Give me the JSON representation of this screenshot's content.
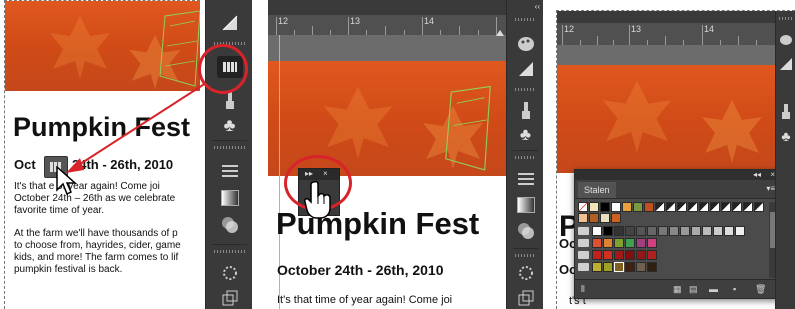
{
  "panel1": {
    "title": "Pumpkin Fest",
    "subtitle_pre": "Oct",
    "subtitle_post": "24th - 26th, 2010",
    "para1": [
      "It's that",
      "e of year again! Come joi",
      "October 24th – 26th as we celebrate",
      "favorite time of year."
    ],
    "para1_lines": [
      "It's that       e of year again! Come joi",
      "October 24th – 26th as we celebrate",
      "favorite time of year."
    ],
    "para2_lines": [
      "At the farm we'll have thousands of p",
      "to choose from, hayrides, cider, game",
      "kids, and more! The farm comes to lif",
      "pumpkin festival is back."
    ]
  },
  "panel2": {
    "ruler_numbers": [
      "12",
      "13",
      "14"
    ],
    "mini_panel_controls": [
      "▸▸",
      "×"
    ],
    "title": "Pumpkin Fest",
    "subtitle": "October 24th - 26th, 2010",
    "body_line": "It's that time of year again! Come joi"
  },
  "panel3": {
    "ruler_numbers": [
      "12",
      "13",
      "14"
    ],
    "swatches_tab": "Stalen",
    "header_controls": [
      "◂◂",
      "×"
    ],
    "menu_icon": "▾≡",
    "title_fragment": "P",
    "sub_fragments": [
      "Oc",
      "Oc"
    ],
    "body_fragment": "t's t"
  },
  "icons": [
    "triangle-shape-icon",
    "swatches-grid-icon",
    "brush-icon",
    "club-icon",
    "lines-icon",
    "gradient-icon",
    "transparency-icon",
    "color-palette-icon",
    "symbol-icon",
    "layers-icon"
  ],
  "colors": {
    "banner": "#d8521c",
    "toolbar": "#3a3a3a",
    "highlight": "#d8232a"
  }
}
